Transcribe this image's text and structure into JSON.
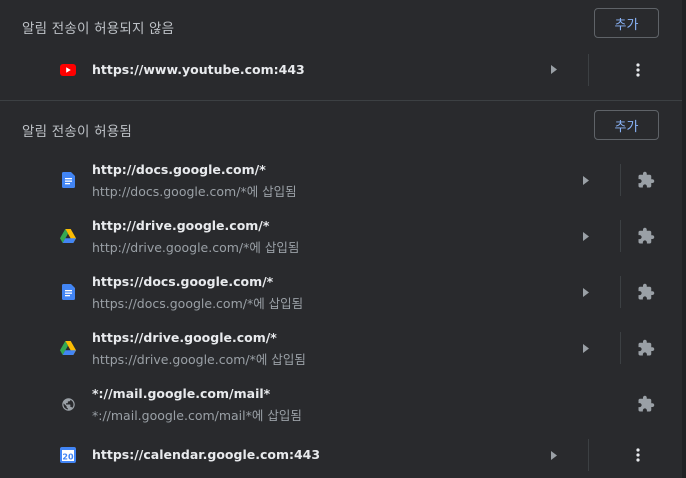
{
  "blocked": {
    "title": "알림 전송이 허용되지 않음",
    "add_label": "추가",
    "sites": [
      {
        "url": "https://www.youtube.com:443",
        "icon": "youtube-icon"
      }
    ]
  },
  "allowed": {
    "title": "알림 전송이 허용됨",
    "add_label": "추가",
    "sites": [
      {
        "url": "http://docs.google.com/*",
        "sub": "http://docs.google.com/*에 삽입됨",
        "icon": "google-docs-icon"
      },
      {
        "url": "http://drive.google.com/*",
        "sub": "http://drive.google.com/*에 삽입됨",
        "icon": "google-drive-icon"
      },
      {
        "url": "https://docs.google.com/*",
        "sub": "https://docs.google.com/*에 삽입됨",
        "icon": "google-docs-icon"
      },
      {
        "url": "https://drive.google.com/*",
        "sub": "https://drive.google.com/*에 삽입됨",
        "icon": "google-drive-icon"
      },
      {
        "url": "*://mail.google.com/mail*",
        "sub": "*://mail.google.com/mail*에 삽입됨",
        "icon": "globe-icon"
      },
      {
        "url": "https://calendar.google.com:443",
        "icon": "google-calendar-icon",
        "calendar_day": "20"
      }
    ]
  },
  "colors": {
    "accent": "#8ab4f8",
    "background": "#292a2d",
    "text_primary": "#e8eaed",
    "text_secondary": "#9aa0a6"
  }
}
